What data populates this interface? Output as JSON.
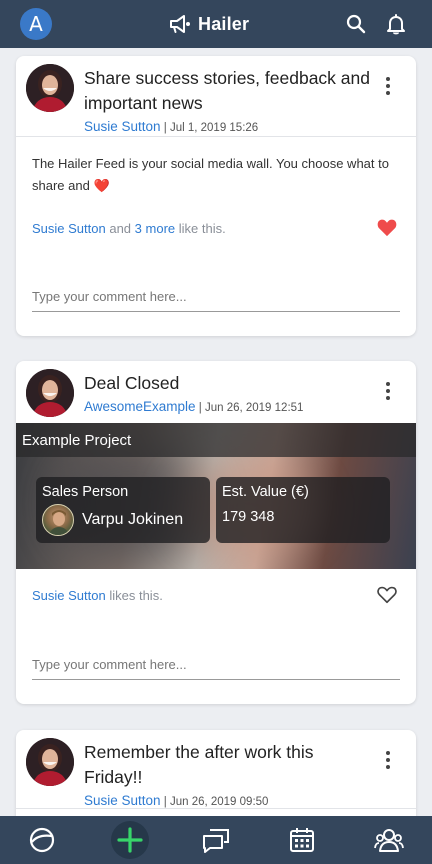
{
  "header": {
    "account_initial": "A",
    "brand": "Hailer"
  },
  "posts": [
    {
      "title": "Share success stories, feedback and important news",
      "author": "Susie Sutton",
      "date": "Jul 1, 2019 15:26",
      "body": "The Hailer Feed is your social media wall. You choose what to share and",
      "body_emoji": "❤️",
      "likes": {
        "first": "Susie Sutton",
        "and": "and",
        "more": "3 more",
        "suffix": "like this.",
        "liked": true
      },
      "comment_placeholder": "Type your comment here..."
    },
    {
      "title": "Deal Closed",
      "author": "AwesomeExample",
      "date": "Jun 26, 2019 12:51",
      "project": "Example Project",
      "fields": [
        {
          "label": "Sales Person",
          "value": "Varpu Jokinen"
        },
        {
          "label": "Est. Value (€)",
          "value": "179 348"
        }
      ],
      "likes": {
        "first": "Susie Sutton",
        "suffix": "likes this.",
        "liked": false
      },
      "comment_placeholder": "Type your comment here..."
    },
    {
      "title": "Remember the after work this Friday!!",
      "author": "Susie Sutton",
      "date": "Jun 26, 2019 09:50"
    }
  ],
  "colors": {
    "topbar": "#34465c",
    "link": "#2f7bd1",
    "heart_red": "#ef4b4b",
    "add_green": "#38d46a"
  },
  "bottom_nav": [
    "feed-icon",
    "add-icon",
    "discussions-icon",
    "calendar-icon",
    "people-icon"
  ]
}
